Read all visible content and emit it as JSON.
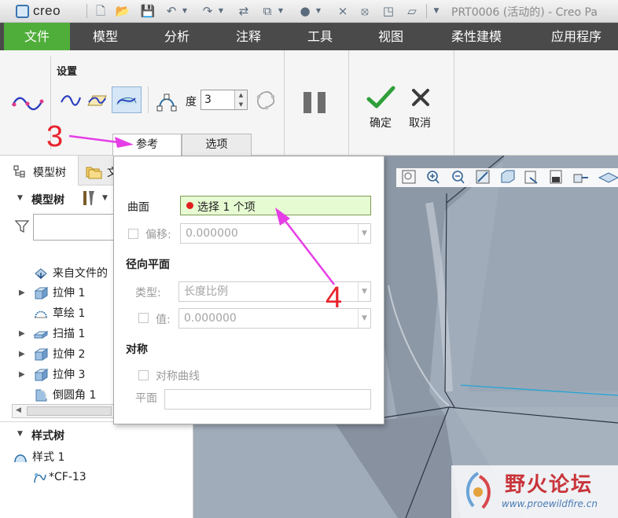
{
  "app": {
    "logo_text": "creo",
    "window_title": "PRT0006 (活动的) - Creo Pa"
  },
  "menu": {
    "tabs": [
      {
        "label": "文件",
        "active": true
      },
      {
        "label": "模型"
      },
      {
        "label": "分析"
      },
      {
        "label": "注释"
      },
      {
        "label": "工具"
      },
      {
        "label": "视图"
      },
      {
        "label": "柔性建模"
      },
      {
        "label": "应用程序"
      }
    ]
  },
  "ribbon": {
    "group_settings_label": "设置",
    "degree_label": "度",
    "degree_value": "3",
    "ok_label": "确定",
    "cancel_label": "取消",
    "tabs": {
      "references": "参考",
      "options": "选项"
    }
  },
  "left_panel": {
    "tabs": {
      "model_tree": "模型树",
      "folder_partial": "文"
    },
    "tree_header": "模型树",
    "tree_items": [
      {
        "label": "来自文件的",
        "icon": "import-icon",
        "expandable": false
      },
      {
        "label": "拉伸 1",
        "icon": "extrude-icon",
        "expandable": true
      },
      {
        "label": "草绘 1",
        "icon": "sketch-icon",
        "expandable": false
      },
      {
        "label": "扫描 1",
        "icon": "sweep-icon",
        "expandable": true
      },
      {
        "label": "拉伸 2",
        "icon": "extrude-icon",
        "expandable": true
      },
      {
        "label": "拉伸 3",
        "icon": "extrude-icon",
        "expandable": true
      },
      {
        "label": "倒圆角 1",
        "icon": "round-icon",
        "expandable": false
      }
    ],
    "style_tree_header": "样式树",
    "style_items": [
      {
        "label": "样式 1",
        "icon": "style-icon"
      },
      {
        "label": "*CF-13",
        "icon": "curve-icon"
      }
    ]
  },
  "popup": {
    "surface_label": "曲面",
    "collector_text": "选择 1 个项",
    "offset_label": "偏移:",
    "offset_value": "0.000000",
    "radial_plane_header": "径向平面",
    "type_label": "类型:",
    "type_value": "长度比例",
    "value_label": "值:",
    "value_value": "0.000000",
    "symmetry_header": "对称",
    "symmetric_curve_label": "对称曲线",
    "plane_label": "平面"
  },
  "annotations": {
    "step3": "3",
    "step4": "4"
  },
  "watermark": {
    "title": "野火论坛",
    "url": "www.proewildfire.cn"
  },
  "colors": {
    "menu_active": "#4fae3a",
    "menu_bg": "#4a4a4a",
    "annotation_red": "#e8232b",
    "arrow_magenta": "#e63ee6",
    "collector_bg": "#e7fbd3",
    "model_bg": "#9da8b6"
  }
}
